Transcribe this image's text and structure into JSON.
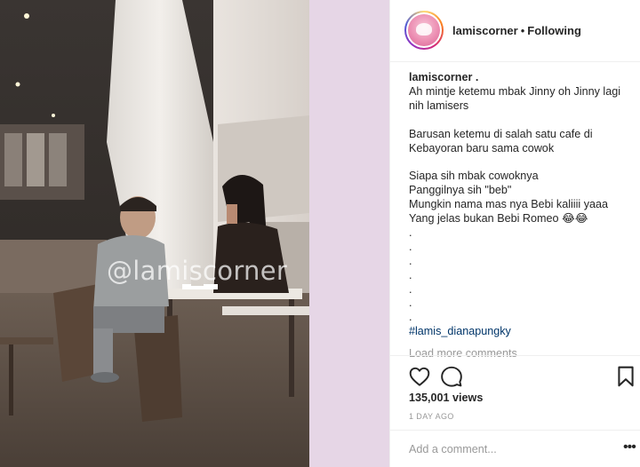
{
  "media": {
    "watermark": "@lamiscorner",
    "alt_context": "cafe photo"
  },
  "header": {
    "username": "lamiscorner",
    "separator": "•",
    "follow_state": "Following"
  },
  "caption": {
    "username": "lamiscorner .",
    "lines": [
      "Ah mintje ketemu mbak Jinny oh Jinny lagi",
      "nih lamisers",
      "",
      "Barusan ketemu di salah satu cafe di",
      "Kebayoran baru sama cowok",
      "",
      "Siapa sih mbak cowoknya",
      "Panggilnya sih \"beb\"",
      "Mungkin nama mas nya Bebi kaliiii yaaa",
      "Yang jelas bukan Bebi Romeo 😂😂",
      ".",
      ".",
      ".",
      ".",
      ".",
      ".",
      "."
    ],
    "hashtag": "#lamis_dianapungky"
  },
  "load_more": "Load more comments",
  "actions": {
    "like_icon": "heart-outline-icon",
    "comment_icon": "comment-bubble-icon",
    "save_icon": "bookmark-outline-icon"
  },
  "stats": {
    "views": "135,001 views",
    "time": "1 DAY AGO"
  },
  "comment": {
    "placeholder": "Add a comment...",
    "more": "•••"
  },
  "colors": {
    "side_pad": "#e6d6e6",
    "hashtag": "#003569",
    "muted": "#999999",
    "text": "#262626",
    "divider": "#efefef"
  }
}
